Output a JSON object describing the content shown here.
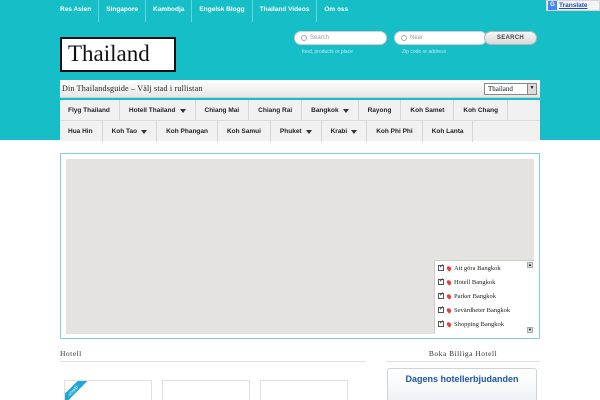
{
  "topnav": [
    "Res Asien",
    "Singapore",
    "Kambodja",
    "Engelsk Blogg",
    "Thailand Videos",
    "Om oss"
  ],
  "translate": {
    "label": "Translate"
  },
  "logo": {
    "text": "Thailand"
  },
  "search": {
    "query_placeholder": "Search",
    "query_hint": "food, products or place",
    "near_placeholder": "Near",
    "near_hint": "Zip code or address",
    "button": "SEARCH"
  },
  "guide": {
    "title": "Din Thailandsguide – Välj stad i rullistan",
    "selected": "Thailand"
  },
  "menu_row1": [
    {
      "label": "Flyg Thailand",
      "dropdown": false
    },
    {
      "label": "Hotell Thailand",
      "dropdown": true
    },
    {
      "label": "Chiang Mai",
      "dropdown": false
    },
    {
      "label": "Chiang Rai",
      "dropdown": false
    },
    {
      "label": "Bangkok",
      "dropdown": true
    },
    {
      "label": "Rayong",
      "dropdown": false
    },
    {
      "label": "Koh Samet",
      "dropdown": false
    },
    {
      "label": "Koh Chang",
      "dropdown": false
    }
  ],
  "menu_row2": [
    {
      "label": "Hua Hin",
      "dropdown": false
    },
    {
      "label": "Koh Tao",
      "dropdown": true
    },
    {
      "label": "Koh Phangan",
      "dropdown": false
    },
    {
      "label": "Koh Samui",
      "dropdown": false
    },
    {
      "label": "Phuket",
      "dropdown": true
    },
    {
      "label": "Krabi",
      "dropdown": true
    },
    {
      "label": "Koh Phi Phi",
      "dropdown": false
    },
    {
      "label": "Koh Lanta",
      "dropdown": false
    }
  ],
  "map_legend": [
    "Att göra Bangkok",
    "Hotell Bangkok",
    "Parker Bangkok",
    "Sevärdheter Bangkok",
    "Shopping Bangkok"
  ],
  "hotell": {
    "title": "Hotell",
    "ribbon": "utvald"
  },
  "sidebar": {
    "title": "Boka Billiga Hotell",
    "deals": "Dagens hotellerbjudanden"
  },
  "colors": {
    "header_bg": "#16bfc7",
    "menu_bg": "#f1f1f1",
    "map_bg": "#e5e3df",
    "link_blue": "#1f56a6"
  }
}
